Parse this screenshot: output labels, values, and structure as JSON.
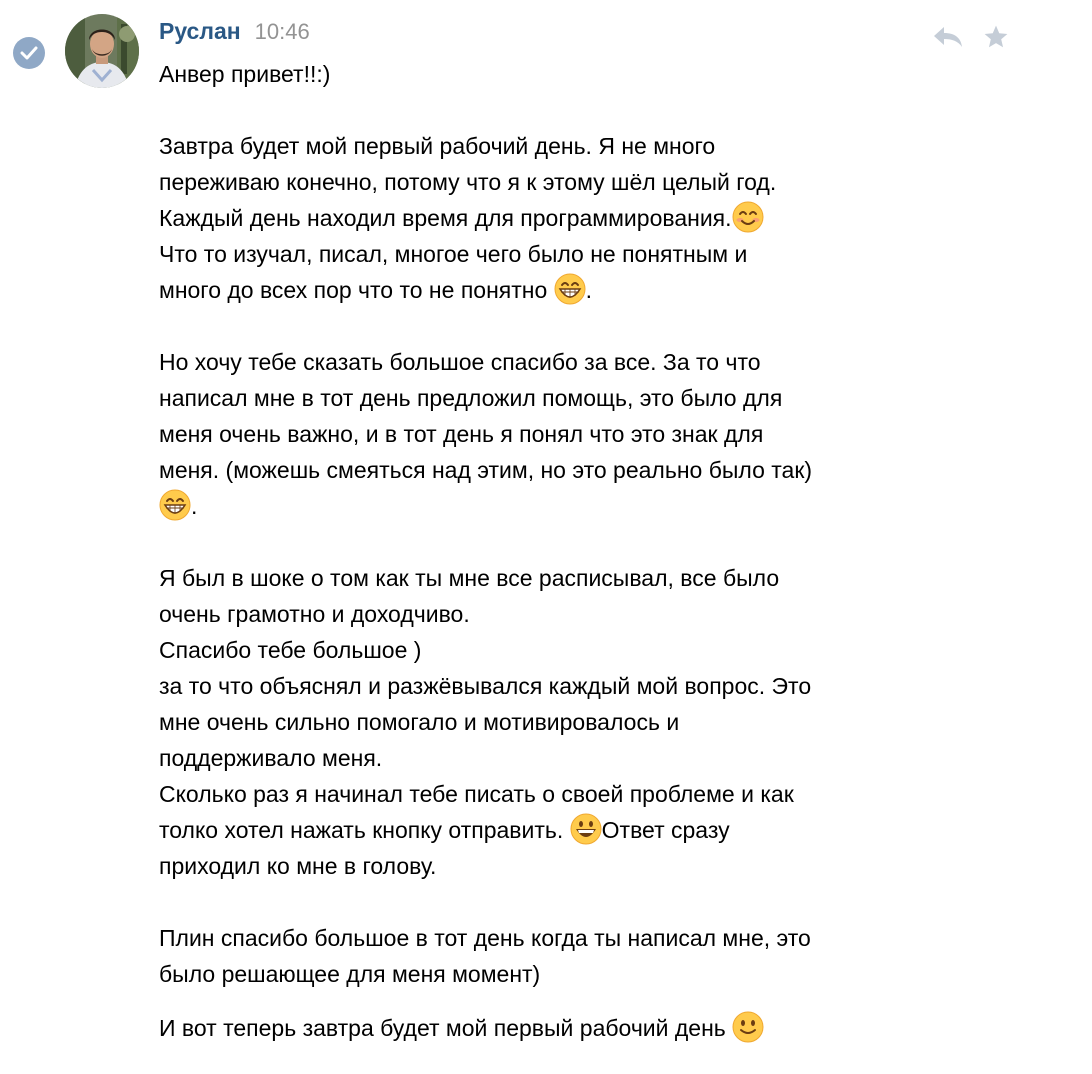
{
  "message": {
    "author": "Руслан",
    "time": "10:46",
    "blocks": [
      "Анвер привет!!:)",
      "Завтра будет мой первый рабочий день. Я не много",
      "переживаю конечно, потому что я к этому шёл целый год.",
      "Каждый день находил время для программирования.",
      "Что то изучал, писал, многое чего было не понятным и",
      "много до всех пор что то не понятно",
      ".",
      "Но хочу тебе сказать большое спасибо за все. За то что",
      "написал мне в тот день предложил помощь, это было для",
      "меня очень важно, и в тот день я понял что это знак для",
      "меня. (можешь смеяться над этим, но это реально было так)",
      ".",
      "Я был в шоке о том как ты мне все расписывал, все было",
      "очень грамотно и доходчиво.",
      "Спасибо тебе большое )",
      "за то что объяснял и разжёвывался каждый мой вопрос. Это",
      "мне очень сильно помогало и мотивировалось и",
      "поддерживало меня.",
      "Сколько раз я начинал тебе писать о своей проблеме и как",
      "толко хотел нажать кнопку отправить. ",
      "Ответ сразу",
      "приходил ко мне в голову.",
      "Плин спасибо большое в тот день когда ты написал мне, это",
      "было решающее для меня момент)",
      "И вот теперь завтра будет мой первый рабочий день "
    ]
  },
  "icons": {
    "verified": "checkmark-circle-icon",
    "reply": "reply-arrow-icon",
    "favorite": "star-icon",
    "emoji_smile": "smiling-face-icon",
    "emoji_grin": "grinning-face-icon",
    "emoji_slight_smile": "slightly-smiling-face-icon"
  },
  "colors": {
    "author": "#2a5885",
    "time": "#939393",
    "action_icons": "#c5cdd7",
    "check_circle": "#8fa8c6"
  }
}
